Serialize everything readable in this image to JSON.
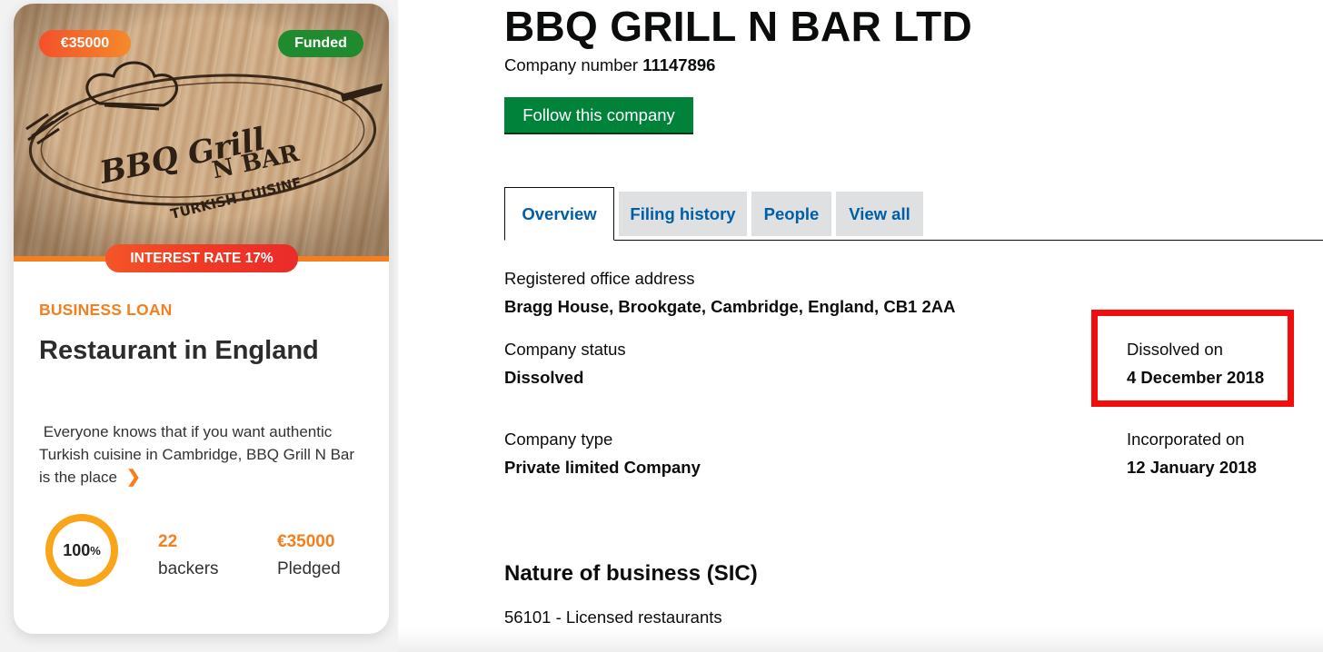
{
  "card": {
    "amount_badge": "€35000",
    "status_badge": "Funded",
    "logo": {
      "line1": "BBQ Grill",
      "line2": "N BAR",
      "line3": "TURKISH CUISINE"
    },
    "interest_badge": "INTEREST RATE 17%",
    "category": "BUSINESS LOAN",
    "title": "Restaurant in England",
    "description": "Everyone knows that if you want authentic Turkish cuisine in Cambridge, BBQ Grill N Bar is the place",
    "progress": {
      "percent_value": "100",
      "percent_sign": "%",
      "fraction": 1.0
    },
    "backers": {
      "value": "22",
      "label": "backers"
    },
    "pledged": {
      "value": "€35000",
      "label": "Pledged"
    },
    "colors": {
      "accent": "#f57f1e",
      "funded": "#1f8a2e",
      "interest": "#f03a24"
    }
  },
  "company": {
    "name": "BBQ GRILL N BAR LTD",
    "number_label": "Company number",
    "number": "11147896",
    "follow_button": "Follow this company",
    "tabs": [
      {
        "label": "Overview",
        "active": true
      },
      {
        "label": "Filing history",
        "active": false
      },
      {
        "label": "People",
        "active": false
      },
      {
        "label": "View all",
        "active": false
      }
    ],
    "registered_office_label": "Registered office address",
    "registered_office": "Bragg House, Brookgate, Cambridge, England, CB1 2AA",
    "status_label": "Company status",
    "status": "Dissolved",
    "dissolved_label": "Dissolved on",
    "dissolved_date": "4 December 2018",
    "type_label": "Company type",
    "type": "Private limited Company",
    "incorporated_label": "Incorporated on",
    "incorporated_date": "12 January 2018",
    "sic_heading": "Nature of business (SIC)",
    "sic_items": [
      "56101 - Licensed restaurants"
    ],
    "colors": {
      "link": "#005ea5",
      "button": "#00823b",
      "highlight": "#f20c0c"
    }
  }
}
